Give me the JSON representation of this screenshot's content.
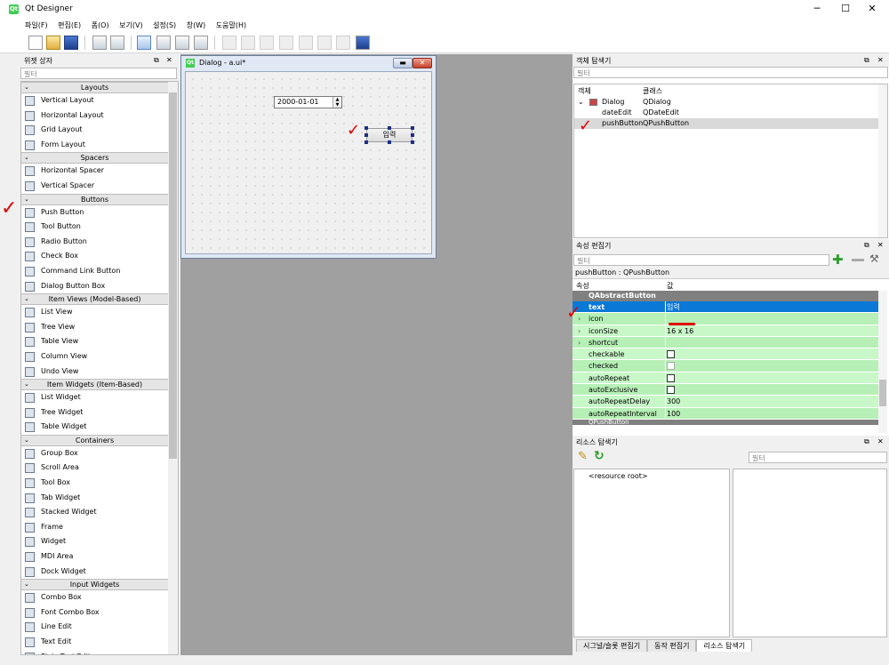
{
  "window": {
    "title": "Qt Designer",
    "logo": "Qt",
    "minimize": "─",
    "maximize": "☐",
    "close": "✕"
  },
  "menu": [
    "파일(F)",
    "편집(E)",
    "폼(O)",
    "보기(V)",
    "설정(S)",
    "창(W)",
    "도움말(H)"
  ],
  "toolbar": {
    "groups": [
      [
        "new-form-icon",
        "open-form-icon",
        "save-form-icon"
      ],
      [
        "bring-to-front-icon",
        "send-to-back-icon"
      ],
      [
        "edit-widgets-icon",
        "edit-signals-slots-icon",
        "edit-buddies-icon",
        "edit-tab-order-icon"
      ],
      [
        "layout-horizontal-icon",
        "layout-vertical-icon",
        "layout-h-splitter-icon",
        "layout-v-splitter-icon",
        "layout-grid-icon",
        "layout-form-icon",
        "break-layout-icon",
        "adjust-size-icon"
      ]
    ]
  },
  "widget_box": {
    "title": "위젯 상자",
    "filter_placeholder": "필터",
    "float_icon": "⧉",
    "close_icon": "✕",
    "categories": [
      {
        "name": "Layouts",
        "items": [
          "Vertical Layout",
          "Horizontal Layout",
          "Grid Layout",
          "Form Layout"
        ]
      },
      {
        "name": "Spacers",
        "items": [
          "Horizontal Spacer",
          "Vertical Spacer"
        ]
      },
      {
        "name": "Buttons",
        "items": [
          "Push Button",
          "Tool Button",
          "Radio Button",
          "Check Box",
          "Command Link Button",
          "Dialog Button Box"
        ]
      },
      {
        "name": "Item Views (Model-Based)",
        "items": [
          "List View",
          "Tree View",
          "Table View",
          "Column View",
          "Undo View"
        ]
      },
      {
        "name": "Item Widgets (Item-Based)",
        "items": [
          "List Widget",
          "Tree Widget",
          "Table Widget"
        ]
      },
      {
        "name": "Containers",
        "items": [
          "Group Box",
          "Scroll Area",
          "Tool Box",
          "Tab Widget",
          "Stacked Widget",
          "Frame",
          "Widget",
          "MDI Area",
          "Dock Widget"
        ]
      },
      {
        "name": "Input Widgets",
        "items": [
          "Combo Box",
          "Font Combo Box",
          "Line Edit",
          "Text Edit",
          "Plain Text Edit"
        ]
      }
    ]
  },
  "dialog": {
    "title": "Dialog - a.ui*",
    "icon": "Qt",
    "minimize": "▬",
    "close": "✕",
    "date_edit_value": "2000-01-01",
    "push_button_text": "입력"
  },
  "object_inspector": {
    "title": "객체 탐색기",
    "filter_placeholder": "필터",
    "columns": [
      "객체",
      "클래스"
    ],
    "rows": [
      {
        "object": "Dialog",
        "class": "QDialog",
        "expander": "⌄"
      },
      {
        "object": "dateEdit",
        "class": "QDateEdit"
      },
      {
        "object": "pushButton",
        "class": "QPushButton",
        "selected": true
      }
    ]
  },
  "property_editor": {
    "title": "속성 편집기",
    "filter_placeholder": "필터",
    "context": "pushButton : QPushButton",
    "columns": [
      "속성",
      "값"
    ],
    "group": "QAbstractButton",
    "next_group": "QPushButton",
    "rows": [
      {
        "name": "text",
        "value": "입력",
        "bold": true,
        "selected": true
      },
      {
        "name": "icon",
        "value": "",
        "expandable": true
      },
      {
        "name": "iconSize",
        "value": "16 x 16",
        "expandable": true
      },
      {
        "name": "shortcut",
        "value": "",
        "expandable": true
      },
      {
        "name": "checkable",
        "checkbox": true
      },
      {
        "name": "checked",
        "checkbox": true,
        "disabled": true
      },
      {
        "name": "autoRepeat",
        "checkbox": true
      },
      {
        "name": "autoExclusive",
        "checkbox": true
      },
      {
        "name": "autoRepeatDelay",
        "value": "300"
      },
      {
        "name": "autoRepeatInterval",
        "value": "100"
      }
    ]
  },
  "resource_browser": {
    "title": "리소스 탐색기",
    "filter_placeholder": "필터",
    "root": "<resource root>",
    "tabs": [
      "시그널/슬롯 편집기",
      "동작 편집기",
      "리소스 탐색기"
    ]
  },
  "annotations": {
    "checkmark": "✓",
    "color": "#e00000"
  }
}
